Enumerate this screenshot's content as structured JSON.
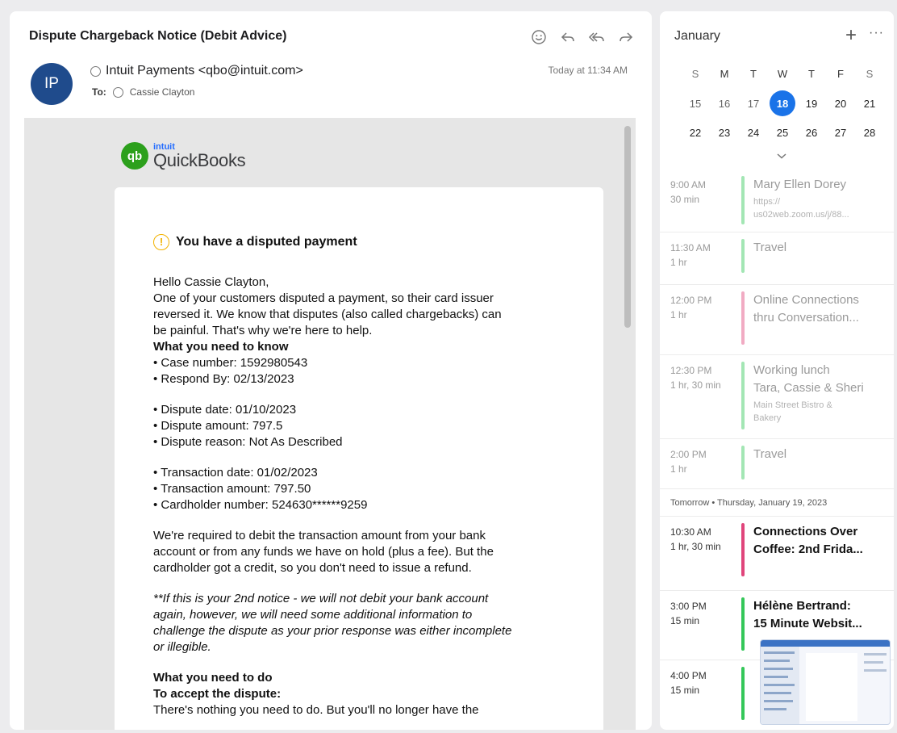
{
  "mail": {
    "subject": "Dispute Chargeback Notice (Debit Advice)",
    "actions": [
      {
        "icon": "smiley-icon"
      },
      {
        "icon": "reply-icon"
      },
      {
        "icon": "reply-all-icon"
      },
      {
        "icon": "forward-icon"
      }
    ],
    "avatar_initials": "IP",
    "avatar_color": "#1f4b8c",
    "from": "Intuit Payments <qbo@intuit.com>",
    "to_label": "To:",
    "to": "Cassie Clayton",
    "date": "Today at 11:34 AM"
  },
  "email": {
    "brand_small": "intuit",
    "brand_name": "QuickBooks",
    "brand_mark": "qb",
    "brand_color": "#2ca01c",
    "alert_title": "You have a disputed payment",
    "greeting": "Hello Cassie Clayton,",
    "intro_1": "One of your customers disputed a payment, so their card issuer",
    "intro_2": "reversed it. We know that disputes (also called chargebacks) can",
    "intro_3": "be painful. That's why we're here to help.",
    "know_heading": "What you need to know",
    "case_number": "• Case number: 1592980543",
    "respond_by": "• Respond By: 02/13/2023",
    "dispute_date": "• Dispute date: 01/10/2023",
    "dispute_amount": "• Dispute amount: 797.5",
    "dispute_reason": "• Dispute reason: Not As Described",
    "transaction_date": "• Transaction date: 01/02/2023",
    "transaction_amount": "• Transaction amount: 797.50",
    "cardholder_number": "• Cardholder number: 524630******9259",
    "debit_1": "We're required to debit the transaction amount from your bank",
    "debit_2": "account or from any funds we have on hold (plus a fee). But the",
    "debit_3": "cardholder got a credit, so you don't need to issue a refund.",
    "notice_1": "**If this is your 2nd notice - we will not debit your bank account",
    "notice_2": "again, however, we will need some additional information to",
    "notice_3": "challenge the dispute as your prior response was either incomplete",
    "notice_4": "or illegible.",
    "do_heading": "What you need to do",
    "accept_heading": "To accept the dispute:",
    "accept_text": "There's nothing you need to do. But you'll no longer have the"
  },
  "calendar": {
    "month": "January",
    "add_icon": "plus-icon",
    "more_icon": "more-icon",
    "weekdays": [
      "S",
      "M",
      "T",
      "W",
      "T",
      "F",
      "S"
    ],
    "week1": [
      "15",
      "16",
      "17",
      "18",
      "19",
      "20",
      "21"
    ],
    "week2": [
      "22",
      "23",
      "24",
      "25",
      "26",
      "27",
      "28"
    ],
    "today": "18",
    "accent": "#1a73e8",
    "events_today": [
      {
        "time": "9:00 AM",
        "duration": "30 min",
        "title": "Mary Ellen Dorey",
        "sub_1": "https://",
        "sub_2": "us02web.zoom.us/j/88...",
        "color": "#34c759"
      },
      {
        "time": "11:30 AM",
        "duration": "1 hr",
        "title": "Travel",
        "color": "#34c759"
      },
      {
        "time": "12:00 PM",
        "duration": "1 hr",
        "title": "Online Connections",
        "title_2": "thru Conversation...",
        "color": "#e0457b"
      },
      {
        "time": "12:30 PM",
        "duration": "1 hr, 30 min",
        "title": "Working lunch",
        "title_2": "Tara, Cassie & Sheri",
        "sub_1": "Main Street Bistro &",
        "sub_2": "Bakery",
        "color": "#34c759"
      },
      {
        "time": "2:00 PM",
        "duration": "1 hr",
        "title": "Travel",
        "color": "#34c759"
      }
    ],
    "tomorrow_label": "Tomorrow • Thursday, January 19, 2023",
    "events_tomorrow": [
      {
        "time": "10:30 AM",
        "duration": "1 hr, 30 min",
        "title": "Connections Over",
        "title_2": "Coffee: 2nd Frida...",
        "color": "#e0457b"
      },
      {
        "time": "3:00 PM",
        "duration": "15 min",
        "title": "Hélène Bertrand:",
        "title_2": "15 Minute Websit...",
        "color": "#34c759"
      },
      {
        "time": "4:00 PM",
        "duration": "15 min",
        "title": "",
        "color": "#34c759"
      }
    ]
  }
}
